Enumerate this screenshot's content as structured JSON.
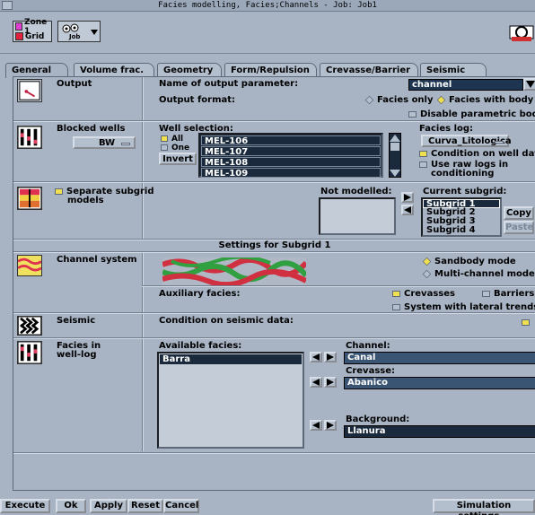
{
  "window": {
    "title": "Facies modelling, Facies;Channels - Job: Job1"
  },
  "toolbar": {
    "zone_label": "Zone 1",
    "grid_label": "Grid",
    "job_label": "Job",
    "zone_color": "#e040d0",
    "grid_color": "#e0203c"
  },
  "tabs": [
    {
      "label": "General"
    },
    {
      "label": "Volume frac."
    },
    {
      "label": "Geometry"
    },
    {
      "label": "Form/Repulsion"
    },
    {
      "label": "Crevasse/Barrier"
    },
    {
      "label": "Seismic"
    }
  ],
  "output": {
    "section_label": "Output",
    "name_label": "Name of output parameter:",
    "name_value": "channel",
    "format_label": "Output format:",
    "opt_facies_only": "Facies only",
    "opt_facies_body": "Facies with body",
    "disable_param_body": "Disable parametric body"
  },
  "blocked_wells": {
    "section_label": "Blocked wells",
    "bw_value": "BW",
    "well_selection_label": "Well selection:",
    "all_label": "All",
    "one_label": "One",
    "invert_label": "Invert",
    "wells": [
      "MEL-106",
      "MEL-107",
      "MEL-108",
      "MEL-109"
    ],
    "facies_log_label": "Facies log:",
    "facies_log_value": "Curva_Litologica",
    "condition_label": "Condition on well data",
    "raw_logs_label_1": "Use raw logs in",
    "raw_logs_label_2": "conditioning"
  },
  "subgrid": {
    "separate_label_1": "Separate subgrid",
    "separate_label_2": "models",
    "not_modelled_label": "Not modelled:",
    "current_label": "Current subgrid:",
    "current_items": [
      "Subgrid 1",
      "Subgrid 2",
      "Subgrid 3",
      "Subgrid 4"
    ],
    "copy_label": "Copy",
    "paste_label": "Paste",
    "settings_header": "Settings for Subgrid 1"
  },
  "channel_system": {
    "section_label": "Channel system",
    "sandbody_mode": "Sandbody mode",
    "multichannel_mode": "Multi-channel mode",
    "aux_label": "Auxiliary facies:",
    "crevasses": "Crevasses",
    "barriers": "Barriers",
    "lateral_trends": "System with lateral trends"
  },
  "seismic": {
    "section_label": "Seismic",
    "condition_label": "Condition on seismic data:"
  },
  "facies_log": {
    "section_label_1": "Facies in",
    "section_label_2": "well-log",
    "available_label": "Available facies:",
    "available_items": [
      "Barra"
    ],
    "channel_label": "Channel:",
    "channel_value": "Canal",
    "crevasse_label": "Crevasse:",
    "crevasse_value": "Abanico",
    "background_label": "Background:",
    "background_value": "Llanura"
  },
  "bottom": {
    "execute": "Execute",
    "ok": "Ok",
    "apply": "Apply",
    "reset": "Reset",
    "cancel": "Cancel",
    "simulation": "Simulation settings..."
  }
}
